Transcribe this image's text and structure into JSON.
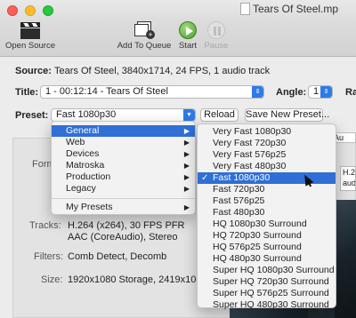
{
  "window": {
    "title": "Tears Of Steel.mp"
  },
  "toolbar": {
    "open_source": "Open Source",
    "add_to_queue": "Add To Queue",
    "start": "Start",
    "pause": "Pause"
  },
  "source": {
    "label": "Source:",
    "value": "Tears Of Steel, 3840x1714, 24 FPS, 1 audio track"
  },
  "title_row": {
    "label": "Title:",
    "value": "1 - 00:12:14 - Tears Of Steel",
    "angle_label": "Angle:",
    "angle_value": "1",
    "range_label": "Ra"
  },
  "preset_row": {
    "label": "Preset:",
    "value": "Fast 1080p30",
    "reload": "Reload",
    "save_new": "Save New Preset..."
  },
  "panel": {
    "tab_partial": "Au",
    "format_label": "Form",
    "h264_partial": [
      "H.26",
      "audi"
    ],
    "tracks_label": "Tracks:",
    "tracks_line1": "H.264 (x264), 30 FPS PFR",
    "tracks_line2": "AAC (CoreAudio), Stereo",
    "filters_label": "Filters:",
    "filters_value": "Comb Detect, Decomb",
    "size_label": "Size:",
    "size_value": "1920x1080 Storage, 2419x1080 Dis"
  },
  "category_menu": {
    "items": [
      "General",
      "Web",
      "Devices",
      "Matroska",
      "Production",
      "Legacy"
    ],
    "selected_index": 0,
    "extra": "My Presets"
  },
  "preset_menu": {
    "items": [
      "Very Fast 1080p30",
      "Very Fast 720p30",
      "Very Fast 576p25",
      "Very Fast 480p30",
      "Fast 1080p30",
      "Fast 720p30",
      "Fast 576p25",
      "Fast 480p30",
      "HQ 1080p30 Surround",
      "HQ 720p30 Surround",
      "HQ 576p25 Surround",
      "HQ 480p30 Surround",
      "Super HQ 1080p30 Surround",
      "Super HQ 720p30 Surround",
      "Super HQ 576p25 Surround",
      "Super HQ 480p30 Surround"
    ],
    "selected_index": 4,
    "check_mark": "✓"
  },
  "icons": {
    "open_source": "clapperboard-icon",
    "add_to_queue": "add-to-queue-icon",
    "start": "play-icon",
    "pause": "pause-icon",
    "submenu": "chevron-right-icon",
    "popup": "chevron-updown-icon"
  },
  "colors": {
    "accent": "#2f6fd6",
    "start_green": "#4a9b2f"
  }
}
